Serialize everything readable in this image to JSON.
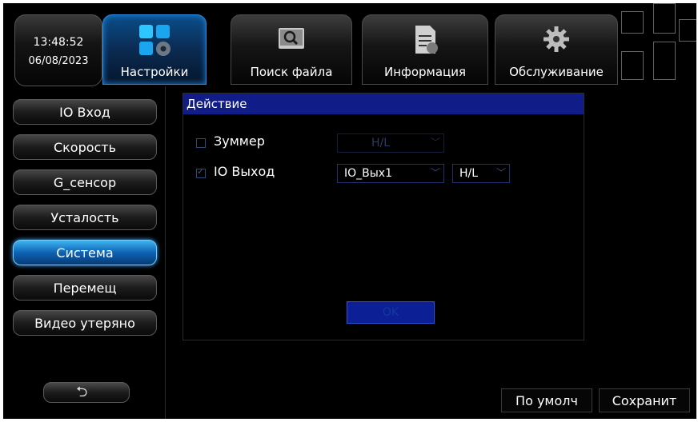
{
  "status": {
    "time": "13:48:52",
    "date": "06/08/2023"
  },
  "tabs": [
    {
      "label": "Настройки",
      "icon": "settings-grid-icon",
      "active": true
    },
    {
      "label": "Поиск файла",
      "icon": "search-icon"
    },
    {
      "label": "Информация",
      "icon": "document-icon"
    },
    {
      "label": "Обслуживание",
      "icon": "gear-icon"
    }
  ],
  "sidebar": {
    "items": [
      {
        "label": "IO Вход"
      },
      {
        "label": "Скорость"
      },
      {
        "label": "G_сенсор"
      },
      {
        "label": "Усталость"
      },
      {
        "label": "Система",
        "active": true
      },
      {
        "label": "Перемещ"
      },
      {
        "label": "Видео утеряно"
      }
    ],
    "back_icon": "return-arrow-icon"
  },
  "dialog": {
    "title": "Действие",
    "rows": [
      {
        "label": "Зуммер",
        "checked": false,
        "select": "H/L"
      },
      {
        "label": "IO Выход",
        "checked": true,
        "select": "IO_Вых1",
        "select2": "H/L"
      }
    ],
    "ok_label": "OK"
  },
  "footer": {
    "default_label": "По умолч",
    "save_label": "Сохранит"
  },
  "colors": {
    "accent": "#1f7fd6",
    "dialog_title_bg": "#101d88"
  }
}
